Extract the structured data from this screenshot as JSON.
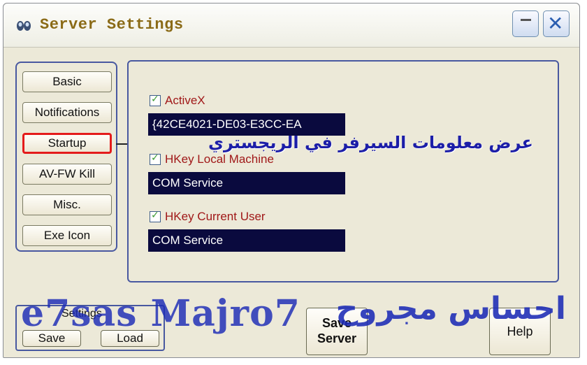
{
  "window": {
    "title": "Server Settings"
  },
  "nav": {
    "items": [
      {
        "label": "Basic"
      },
      {
        "label": "Notifications"
      },
      {
        "label": "Startup",
        "selected": true
      },
      {
        "label": "AV-FW Kill"
      },
      {
        "label": "Misc."
      },
      {
        "label": "Exe Icon"
      }
    ]
  },
  "startup": {
    "activex": {
      "label": "ActiveX",
      "checked": true,
      "value": "{42CE4021-DE03-E3CC-EA"
    },
    "hklm": {
      "label": "HKey Local Machine",
      "checked": true,
      "value": "COM Service"
    },
    "hkcu": {
      "label": "HKey Current User",
      "checked": true,
      "value": "COM Service"
    }
  },
  "annotations": {
    "arabic_note": "عرض معلومات السيرفر في الريجستري",
    "watermark_latin": "e7sas Majro7",
    "watermark_arabic": "احساس مجروح"
  },
  "settings_group": {
    "title": "Settings",
    "save_label": "Save",
    "load_label": "Load"
  },
  "actions": {
    "save_server_line1": "Save",
    "save_server_line2": "Server",
    "help_label": "Help"
  },
  "colors": {
    "selected_border": "#e41b1b",
    "field_bg": "#0a0a3e",
    "checkbox_label": "#a01818",
    "title_color": "#8a6a16",
    "watermark": "#1c2bb6"
  },
  "icons": {
    "app": "alien-eyes-icon",
    "minimize": "minimize-icon",
    "close": "close-icon",
    "checkbox": "checkmark-icon"
  }
}
